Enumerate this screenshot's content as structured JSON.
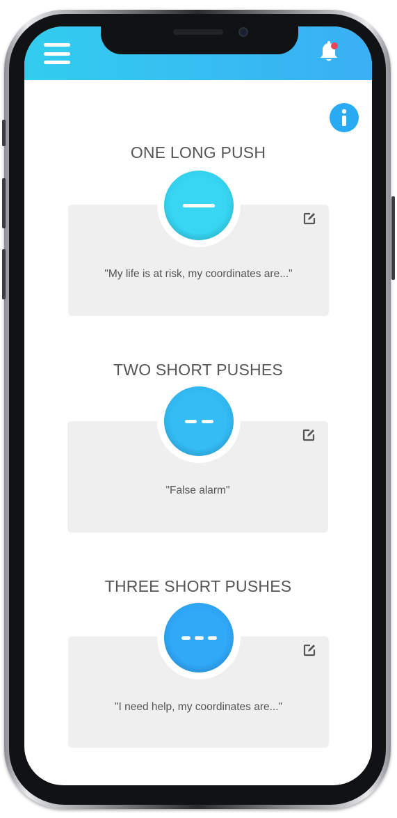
{
  "header": {
    "menu_icon": "hamburger-menu-icon",
    "notification_icon": "bell-icon",
    "gradient_start": "#32cdee",
    "gradient_end": "#3aaff5"
  },
  "info_icon": "info-icon",
  "sections": [
    {
      "title": "ONE LONG PUSH",
      "message": "\"My life is at risk, my coordinates are...\"",
      "button_color": "#35d3ef",
      "pattern": "long"
    },
    {
      "title": "TWO SHORT PUSHES",
      "message": "\"False alarm\"",
      "button_color": "#33b9f2",
      "pattern": "two-short"
    },
    {
      "title": "THREE SHORT PUSHES",
      "message": "\"I need help, my coordinates are...\"",
      "button_color": "#2fa6f5",
      "pattern": "three-short"
    }
  ],
  "edit_icon": "edit-pencil-icon"
}
